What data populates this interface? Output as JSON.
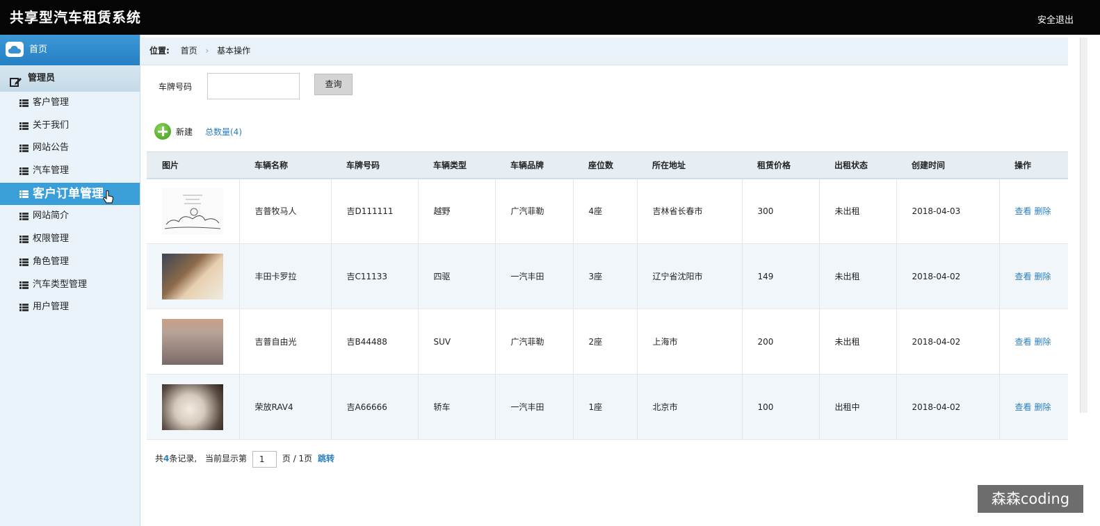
{
  "header": {
    "title": "共享型汽车租赁系统",
    "logout": "安全退出"
  },
  "sidebar": {
    "home": "首页",
    "admin": "管理员",
    "items": [
      "客户管理",
      "关于我们",
      "网站公告",
      "汽车管理",
      "客户订单管理",
      "网站简介",
      "权限管理",
      "角色管理",
      "汽车类型管理",
      "用户管理"
    ]
  },
  "breadcrumb": {
    "label": "位置:",
    "home": "首页",
    "current": "基本操作"
  },
  "search": {
    "label": "车牌号码",
    "value": "",
    "button": "查询"
  },
  "toolbar": {
    "new_label": "新建",
    "total": "总数量(4)"
  },
  "table": {
    "headers": [
      "图片",
      "车辆名称",
      "车牌号码",
      "车辆类型",
      "车辆品牌",
      "座位数",
      "所在地址",
      "租赁价格",
      "出租状态",
      "创建时间",
      "操作"
    ],
    "rows": [
      {
        "name": "吉普牧马人",
        "plate": "吉D111111",
        "type": "越野",
        "brand": "广汽菲勒",
        "seats": "4座",
        "address": "吉林省长春市",
        "price": "300",
        "status": "未出租",
        "created": "2018-04-03"
      },
      {
        "name": "丰田卡罗拉",
        "plate": "吉C11133",
        "type": "四驱",
        "brand": "一汽丰田",
        "seats": "3座",
        "address": "辽宁省沈阳市",
        "price": "149",
        "status": "未出租",
        "created": "2018-04-02"
      },
      {
        "name": "吉普自由光",
        "plate": "吉B44488",
        "type": "SUV",
        "brand": "广汽菲勒",
        "seats": "2座",
        "address": "上海市",
        "price": "200",
        "status": "未出租",
        "created": "2018-04-02"
      },
      {
        "name": "荣放RAV4",
        "plate": "吉A66666",
        "type": "轿车",
        "brand": "一汽丰田",
        "seats": "1座",
        "address": "北京市",
        "price": "100",
        "status": "出租中",
        "created": "2018-04-02"
      }
    ],
    "actions": {
      "view": "查看",
      "delete": "删除"
    }
  },
  "pager": {
    "prefix": "共",
    "count": "4",
    "suffix": "条记录,",
    "current_prefix": "当前显示第",
    "page": "1",
    "page_suffix": "页 / 1页",
    "jump": "跳转"
  },
  "watermark": "森森coding"
}
